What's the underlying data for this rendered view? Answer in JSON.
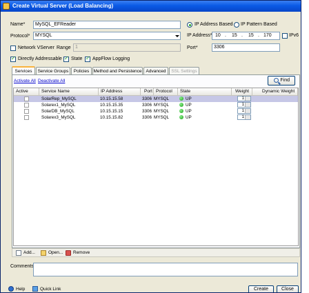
{
  "window": {
    "title": "Create Virtual Server (Load Balancing)"
  },
  "form": {
    "name_label": "Name*",
    "name_value": "MySQL_EFReader",
    "ip_address_based_label": "IP Address Based",
    "ip_pattern_based_label": "IP Pattern Based",
    "protocol_label": "Protocol*",
    "protocol_value": "MYSQL",
    "ip_address_label": "IP Address*",
    "ip_octets": [
      "10",
      "15",
      "15",
      "170"
    ],
    "ipv6_label": "IPv6",
    "network_vserver_label": "Network VServer",
    "range_label": "Range",
    "range_value": "1",
    "port_label": "Port*",
    "port_value": "3306",
    "directly_addressable_label": "Directly Addressable",
    "state_label": "State",
    "appflow_logging_label": "AppFlow Logging"
  },
  "tabs": [
    {
      "label": "Services"
    },
    {
      "label": "Service Groups"
    },
    {
      "label": "Policies"
    },
    {
      "label": "Method and Persistence"
    },
    {
      "label": "Advanced"
    },
    {
      "label": "SSL Settings"
    }
  ],
  "services_panel": {
    "activate_all": "Activate All",
    "deactivate_all": "Deactivate All",
    "find_label": "Find",
    "columns": [
      "Active",
      "Service Name",
      "IP Address",
      "Port",
      "Protocol",
      "State",
      "Weight",
      "Dynamic Weight"
    ],
    "rows": [
      {
        "service_name": "SolarRep_MySQL",
        "ip": "10.15.15.58",
        "port": "3306",
        "protocol": "MYSQL",
        "state": "UP",
        "weight": "1"
      },
      {
        "service_name": "Solarex1_MySQL",
        "ip": "10.15.15.35",
        "port": "3306",
        "protocol": "MYSQL",
        "state": "UP",
        "weight": "1"
      },
      {
        "service_name": "SolarDB_MySQL",
        "ip": "10.15.15.15",
        "port": "3306",
        "protocol": "MYSQL",
        "state": "UP",
        "weight": "1"
      },
      {
        "service_name": "Solarex3_MySQL",
        "ip": "10.15.15.82",
        "port": "3306",
        "protocol": "MYSQL",
        "state": "UP",
        "weight": "1"
      }
    ]
  },
  "panel_toolbar": {
    "add": "Add...",
    "open": "Open...",
    "remove": "Remove"
  },
  "comments_label": "Comments",
  "footer": {
    "help": "Help",
    "quick_link": "Quick Link",
    "create": "Create",
    "close": "Close"
  },
  "colors": {
    "title_bar": "#0a5ae6",
    "selected_row": "#c6c7e6",
    "link": "#0000cc",
    "state_up": "#189a18"
  }
}
